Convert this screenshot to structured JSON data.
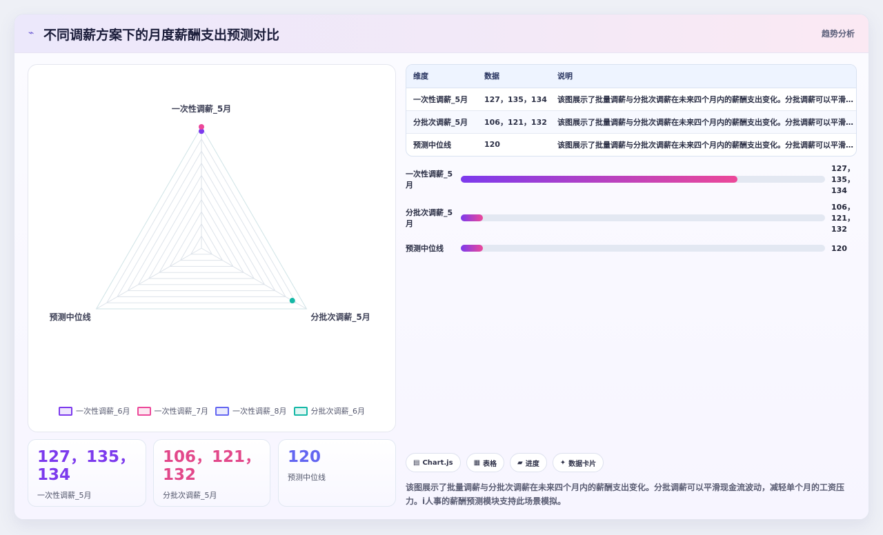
{
  "header": {
    "icon": "trend-line-icon",
    "title": "不同调薪方案下的月度薪酬支出预测对比",
    "tag": "趋势分析"
  },
  "chart_data": {
    "type": "radar",
    "axes": [
      "一次性调薪_5月",
      "分批次调薪_5月",
      "预测中位线"
    ],
    "range": [
      0,
      140
    ],
    "grid_levels": 10,
    "series": [
      {
        "name": "一次性调薪_6月",
        "color": "#7c3aed",
        "values": [
          135,
          0,
          0
        ]
      },
      {
        "name": "一次性调薪_7月",
        "color": "#ec4899",
        "values": [
          140,
          0,
          0
        ]
      },
      {
        "name": "一次性调薪_8月",
        "color": "#6366f1",
        "values": [
          0,
          0,
          0
        ]
      },
      {
        "name": "分批次调薪_6月",
        "color": "#14b8a6",
        "values": [
          0,
          121,
          0
        ]
      }
    ],
    "legend_position": "bottom"
  },
  "kpis": [
    {
      "value": "127，135，134",
      "label": "一次性调薪_5月",
      "color": "#7c3aed"
    },
    {
      "value": "106，121，132",
      "label": "分批次调薪_5月",
      "color": "#e2488a"
    },
    {
      "value": "120",
      "label": "预测中位线",
      "color": "#6366f1"
    }
  ],
  "table": {
    "headers": [
      "维度",
      "数据",
      "说明"
    ],
    "rows": [
      [
        "一次性调薪_5月",
        "127，135，134",
        "该图展示了批量调薪与分批次调薪在未来四个月内的薪酬支出变化。分批调薪可以平滑现金流波动，减轻单个月的工资压力。"
      ],
      [
        "分批次调薪_5月",
        "106，121，132",
        "该图展示了批量调薪与分批次调薪在未来四个月内的薪酬支出变化。分批调薪可以平滑现金流波动，减轻单个月的工资压力。"
      ],
      [
        "预测中位线",
        "120",
        "该图展示了批量调薪与分批次调薪在未来四个月内的薪酬支出变化。分批调薪可以平滑现金流波动，减轻单个月的工资压力。"
      ]
    ]
  },
  "progress": [
    {
      "label": "一次性调薪_5月",
      "value_text": "127，135，134",
      "fill": 0.76
    },
    {
      "label": "分批次调薪_5月",
      "value_text": "106，121，132",
      "fill": 0.06
    },
    {
      "label": "预测中位线",
      "value_text": "120",
      "fill": 0.06
    }
  ],
  "chips": [
    {
      "icon": "chart-icon",
      "label": "Chart.js"
    },
    {
      "icon": "table-icon",
      "label": "表格"
    },
    {
      "icon": "progress-icon",
      "label": "进度"
    },
    {
      "icon": "sparkle-icon",
      "label": "数据卡片"
    }
  ],
  "description": "该图展示了批量调薪与分批次调薪在未来四个月内的薪酬支出变化。分批调薪可以平滑现金流波动，减轻单个月的工资压力。i人事的薪酬预测模块支持此场景模拟。"
}
